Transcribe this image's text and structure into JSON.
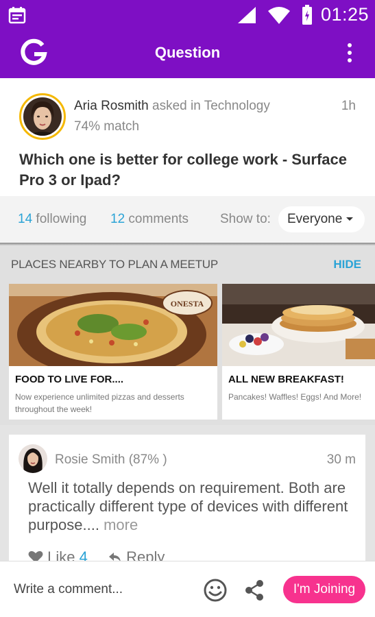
{
  "status_bar": {
    "time": "01:25",
    "icons": [
      "calendar-icon",
      "signal-icon",
      "wifi-icon",
      "battery-icon"
    ]
  },
  "app_bar": {
    "title": "Question",
    "logo": "G",
    "icons": [
      "logo-icon",
      "overflow-menu-icon"
    ]
  },
  "question": {
    "author_name": "Aria Rosmith",
    "asked_in": "asked in Technology",
    "time": "1h",
    "match": "74% match",
    "text": "Which one is better for college work - Surface Pro 3  or Ipad?"
  },
  "stats": {
    "following_count": "14",
    "following_label": "following",
    "comments_count": "12",
    "comments_label": "comments",
    "show_to_label": "Show to:",
    "show_to_value": "Everyone"
  },
  "nearby": {
    "heading": "PLACES NEARBY TO PLAN A MEETUP",
    "hide_label": "HIDE",
    "cards": [
      {
        "title": "FOOD TO LIVE FOR....",
        "description": "Now experience unlimited pizzas and desserts throughout the week!",
        "badge": "ONESTA"
      },
      {
        "title": "ALL NEW BREAKFAST!",
        "description": "Pancakes! Waffles! Eggs! And More!"
      }
    ]
  },
  "answer": {
    "author": "Rosie Smith (87% )",
    "time": "30 m",
    "text": "Well it totally depends on requirement. Both are practically different type of devices with different purpose....",
    "more_label": "more",
    "like_label": "Like",
    "like_count": "4",
    "reply_label": "Reply"
  },
  "compose": {
    "placeholder": "Write a comment...",
    "join_label": "I'm Joining",
    "icons": [
      "emoji-icon",
      "share-icon"
    ]
  },
  "colors": {
    "brand": "#7e0fc4",
    "accent_blue": "#2aa3d6",
    "join_pink": "#f7328e",
    "avatar_ring": "#f5b800"
  }
}
